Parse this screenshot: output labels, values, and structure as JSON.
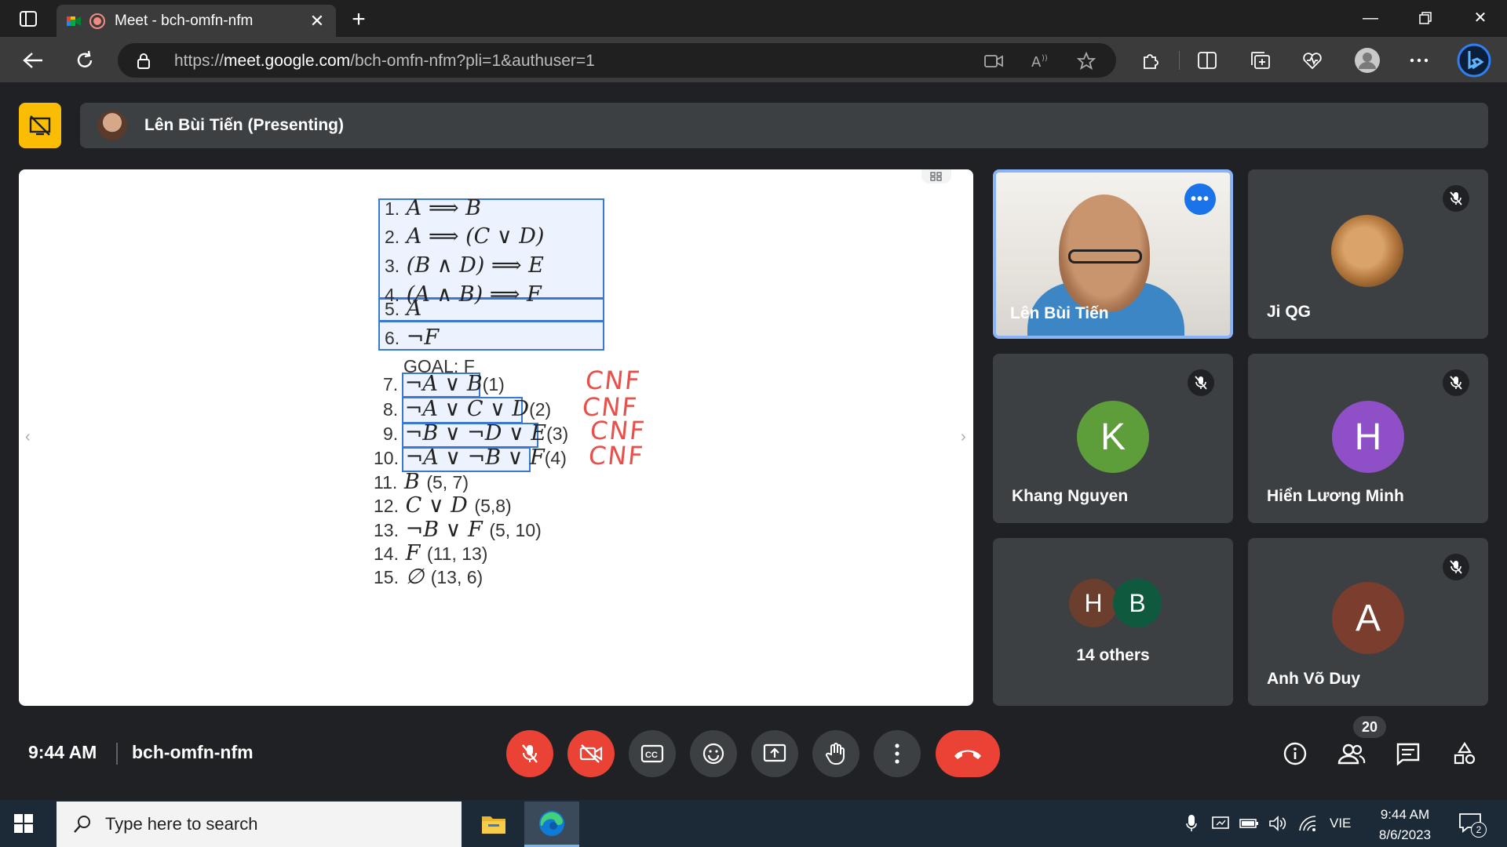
{
  "browser": {
    "tab_title": "Meet - bch-omfn-nfm",
    "url_prefix": "https://",
    "url_domain": "meet.google.com",
    "url_path": "/bch-omfn-nfm?pli=1&authuser=1"
  },
  "presenting": {
    "label": "Lên Bùi Tiến (Presenting)"
  },
  "slide": {
    "kb": [
      {
        "n": "1.",
        "expr": "A ⟹ B"
      },
      {
        "n": "2.",
        "expr": "A ⟹ (C ∨ D)"
      },
      {
        "n": "3.",
        "expr": "(B ∧ D) ⟹ E"
      },
      {
        "n": "4.",
        "expr": "(A ∧ B) ⟹ F"
      },
      {
        "n": "5.",
        "expr": "A"
      },
      {
        "n": "6.",
        "expr": "¬F"
      }
    ],
    "goal": "GOAL: F",
    "cnf": [
      {
        "n": "7.",
        "expr": "¬A ∨ B",
        "ref": "(1)"
      },
      {
        "n": "8.",
        "expr": "¬A ∨ C ∨ D",
        "ref": "(2)"
      },
      {
        "n": "9.",
        "expr": "¬B ∨ ¬D ∨ E",
        "ref": "(3)"
      },
      {
        "n": "10.",
        "expr": "¬A ∨ ¬B ∨ F",
        "ref": "(4)"
      }
    ],
    "derived": [
      {
        "n": "11.",
        "expr": "B",
        "ref": "(5, 7)"
      },
      {
        "n": "12.",
        "expr": "C ∨ D",
        "ref": "(5,8)"
      },
      {
        "n": "13.",
        "expr": "¬B ∨ F",
        "ref": "(5, 10)"
      },
      {
        "n": "14.",
        "expr": "F",
        "ref": "(11, 13)"
      },
      {
        "n": "15.",
        "expr": "∅",
        "ref": "(13, 6)"
      }
    ],
    "handwritten": [
      "CNF",
      "CNF",
      "CNF",
      "CNF"
    ]
  },
  "participants": {
    "presenter_tile": "Lên Bùi Tiến",
    "ji": "Ji QG",
    "khang": {
      "name": "Khang Nguyen",
      "initial": "K",
      "color": "#5d9e3a"
    },
    "hien": {
      "name": "Hiển Lương Minh",
      "initial": "H",
      "color": "#8e4fc7"
    },
    "others": {
      "label": "14 others",
      "a1": "H",
      "a1_color": "#6b3e2e",
      "a2": "B",
      "a2_color": "#0f5a3f"
    },
    "anh": {
      "name": "Anh Võ Duy",
      "initial": "A",
      "color": "#7a3d2e"
    }
  },
  "bottom": {
    "time": "9:44 AM",
    "meeting_code": "bch-omfn-nfm",
    "people_count": "20"
  },
  "taskbar": {
    "search_placeholder": "Type here to search",
    "lang": "VIE",
    "time": "9:44 AM",
    "date": "8/6/2023",
    "notif_count": "2"
  }
}
